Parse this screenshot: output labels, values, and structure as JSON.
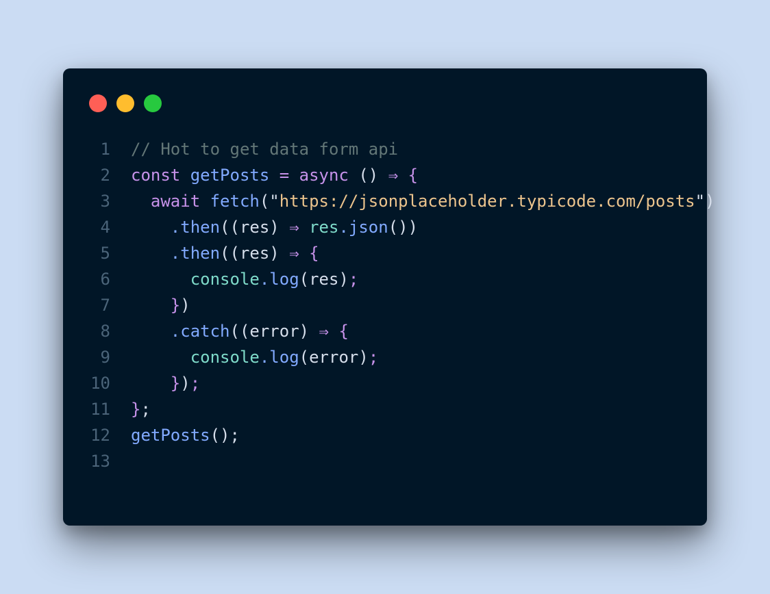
{
  "colors": {
    "background": "#cbdcf3",
    "window": "#011627",
    "dot_red": "#ff5f56",
    "dot_yellow": "#ffbd2e",
    "dot_green": "#27c93f"
  },
  "dots": [
    {
      "name": "close-dot-icon",
      "color": "#ff5f56"
    },
    {
      "name": "minimize-dot-icon",
      "color": "#ffbd2e"
    },
    {
      "name": "maximize-dot-icon",
      "color": "#27c93f"
    }
  ],
  "code_lines": [
    {
      "n": "1",
      "tokens": [
        {
          "t": "// Hot to get data form api",
          "k": "comment"
        }
      ]
    },
    {
      "n": "2",
      "tokens": [
        {
          "t": "const ",
          "k": "keyword"
        },
        {
          "t": "getPosts",
          "k": "func"
        },
        {
          "t": " = ",
          "k": "keyword"
        },
        {
          "t": "async",
          "k": "keyword"
        },
        {
          "t": " () ",
          "k": "paren"
        },
        {
          "t": "⇒",
          "k": "keyword"
        },
        {
          "t": " {",
          "k": "bracket"
        }
      ]
    },
    {
      "n": "3",
      "tokens": [
        {
          "t": "  await ",
          "k": "keyword"
        },
        {
          "t": "fetch",
          "k": "func"
        },
        {
          "t": "(\"",
          "k": "punct"
        },
        {
          "t": "https://jsonplaceholder.typicode.com/posts",
          "k": "string"
        },
        {
          "t": "\")",
          "k": "punct"
        }
      ]
    },
    {
      "n": "4",
      "tokens": [
        {
          "t": "    .",
          "k": "func"
        },
        {
          "t": "then",
          "k": "func"
        },
        {
          "t": "((res) ",
          "k": "ident"
        },
        {
          "t": "⇒",
          "k": "keyword"
        },
        {
          "t": " res",
          "k": "method"
        },
        {
          "t": ".",
          "k": "func"
        },
        {
          "t": "json",
          "k": "func"
        },
        {
          "t": "())",
          "k": "paren"
        }
      ]
    },
    {
      "n": "5",
      "tokens": [
        {
          "t": "    .",
          "k": "func"
        },
        {
          "t": "then",
          "k": "func"
        },
        {
          "t": "((res) ",
          "k": "ident"
        },
        {
          "t": "⇒",
          "k": "keyword"
        },
        {
          "t": " {",
          "k": "bracket"
        }
      ]
    },
    {
      "n": "6",
      "tokens": [
        {
          "t": "      console",
          "k": "method"
        },
        {
          "t": ".",
          "k": "func"
        },
        {
          "t": "log",
          "k": "func"
        },
        {
          "t": "(res)",
          "k": "paren"
        },
        {
          "t": ";",
          "k": "keyword"
        }
      ]
    },
    {
      "n": "7",
      "tokens": [
        {
          "t": "    }",
          "k": "bracket"
        },
        {
          "t": ")",
          "k": "paren"
        }
      ]
    },
    {
      "n": "8",
      "tokens": [
        {
          "t": "    .",
          "k": "func"
        },
        {
          "t": "catch",
          "k": "func"
        },
        {
          "t": "((error) ",
          "k": "ident"
        },
        {
          "t": "⇒",
          "k": "keyword"
        },
        {
          "t": " {",
          "k": "bracket"
        }
      ]
    },
    {
      "n": "9",
      "tokens": [
        {
          "t": "      console",
          "k": "method"
        },
        {
          "t": ".",
          "k": "func"
        },
        {
          "t": "log",
          "k": "func"
        },
        {
          "t": "(error)",
          "k": "paren"
        },
        {
          "t": ";",
          "k": "keyword"
        }
      ]
    },
    {
      "n": "10",
      "tokens": [
        {
          "t": "    }",
          "k": "bracket"
        },
        {
          "t": ")",
          "k": "paren"
        },
        {
          "t": ";",
          "k": "keyword"
        }
      ]
    },
    {
      "n": "11",
      "tokens": [
        {
          "t": "}",
          "k": "bracket"
        },
        {
          "t": ";",
          "k": "punct"
        }
      ]
    },
    {
      "n": "12",
      "tokens": [
        {
          "t": "getPosts",
          "k": "func"
        },
        {
          "t": "()",
          "k": "paren"
        },
        {
          "t": ";",
          "k": "punct"
        }
      ]
    },
    {
      "n": "13",
      "tokens": []
    }
  ]
}
